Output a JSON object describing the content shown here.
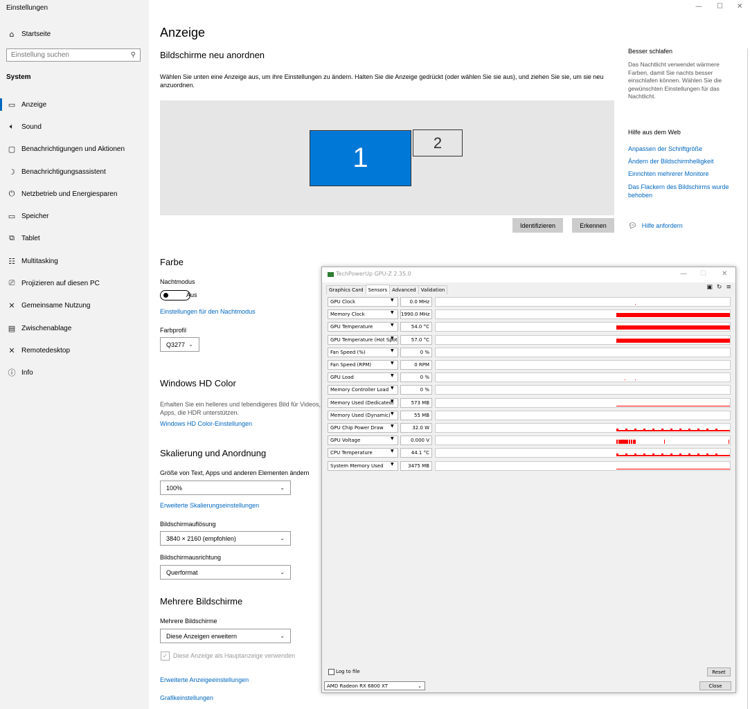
{
  "window": {
    "title": "Einstellungen",
    "min": "—",
    "max": "☐",
    "close": "✕"
  },
  "sidebar": {
    "home": "Startseite",
    "search_placeholder": "Einstellung suchen",
    "section": "System",
    "items": [
      {
        "label": "Anzeige",
        "icon": "monitor-icon"
      },
      {
        "label": "Sound",
        "icon": "speaker-icon"
      },
      {
        "label": "Benachrichtigungen und Aktionen",
        "icon": "notification-icon"
      },
      {
        "label": "Benachrichtigungsassistent",
        "icon": "moon-icon"
      },
      {
        "label": "Netzbetrieb und Energiesparen",
        "icon": "power-icon"
      },
      {
        "label": "Speicher",
        "icon": "storage-icon"
      },
      {
        "label": "Tablet",
        "icon": "tablet-icon"
      },
      {
        "label": "Multitasking",
        "icon": "multitasking-icon"
      },
      {
        "label": "Projizieren auf diesen PC",
        "icon": "project-icon"
      },
      {
        "label": "Gemeinsame Nutzung",
        "icon": "share-icon"
      },
      {
        "label": "Zwischenablage",
        "icon": "clipboard-icon"
      },
      {
        "label": "Remotedesktop",
        "icon": "remote-icon"
      },
      {
        "label": "Info",
        "icon": "info-icon"
      }
    ]
  },
  "main": {
    "title": "Anzeige",
    "arrange_heading": "Bildschirme neu anordnen",
    "arrange_text": "Wählen Sie unten eine Anzeige aus, um ihre Einstellungen zu ändern. Halten Sie die Anzeige gedrückt (oder wählen Sie sie aus), und ziehen Sie sie, um sie neu anzuordnen.",
    "monitor1": "1",
    "monitor2": "2",
    "identify_btn": "Identifizieren",
    "detect_btn": "Erkennen",
    "color_heading": "Farbe",
    "nightmode_label": "Nachtmodus",
    "nightmode_state": "Aus",
    "nightmode_link": "Einstellungen für den Nachtmodus",
    "profile_label": "Farbprofil",
    "profile_value": "Q3277",
    "hdr_heading": "Windows HD Color",
    "hdr_text_1": "Erhalten Sie ein helleres und lebendigeres Bild für Videos,",
    "hdr_text_2": "Apps, die HDR unterstützen.",
    "hdr_link": "Windows HD Color-Einstellungen",
    "scale_heading": "Skalierung und Anordnung",
    "scale_label": "Größe von Text, Apps und anderen Elementen ändern",
    "scale_value": "100%",
    "scale_link": "Erweiterte Skalierungseinstellungen",
    "res_label": "Bildschirmauflösung",
    "res_value": "3840 × 2160 (empfohlen)",
    "orient_label": "Bildschirmausrichtung",
    "orient_value": "Querformat",
    "multi_heading": "Mehrere Bildschirme",
    "multi_label": "Mehrere Bildschirme",
    "multi_value": "Diese Anzeigen erweitern",
    "main_display_label": "Diese Anzeige als Hauptanzeige verwenden",
    "adv_display_link": "Erweiterte Anzeigeeinstellungen",
    "graphics_link": "Grafikeinstellungen"
  },
  "right": {
    "sleep_heading": "Besser schlafen",
    "sleep_text": "Das Nachtlicht verwendet wärmere Farben, damit Sie nachts besser einschlafen können. Wählen Sie die gewünschten Einstellungen für das Nachtlicht.",
    "help_heading": "Hilfe aus dem Web",
    "links": [
      "Anpassen der Schriftgröße",
      "Ändern der Bildschirmhelligkeit",
      "Einrichten mehrerer Monitore",
      "Das Flackern des Bildschirms wurde behoben"
    ],
    "get_help": "Hilfe anfordern"
  },
  "gpuz": {
    "title": "TechPowerUp GPU-Z 2.35.0",
    "tabs": [
      "Graphics Card",
      "Sensors",
      "Advanced",
      "Validation"
    ],
    "active_tab": "Sensors",
    "sensors": [
      {
        "name": "GPU Clock",
        "value": "0.0 MHz"
      },
      {
        "name": "Memory Clock",
        "value": "1990.0 MHz"
      },
      {
        "name": "GPU Temperature",
        "value": "54.0 °C"
      },
      {
        "name": "GPU Temperature (Hot Spot)",
        "value": "57.0 °C"
      },
      {
        "name": "Fan Speed (%)",
        "value": "0 %"
      },
      {
        "name": "Fan Speed (RPM)",
        "value": "0 RPM"
      },
      {
        "name": "GPU Load",
        "value": "0 %"
      },
      {
        "name": "Memory Controller Load",
        "value": "0 %"
      },
      {
        "name": "Memory Used (Dedicated)",
        "value": "573 MB"
      },
      {
        "name": "Memory Used (Dynamic)",
        "value": "55 MB"
      },
      {
        "name": "GPU Chip Power Draw",
        "value": "32.0 W"
      },
      {
        "name": "GPU Voltage",
        "value": "0.000 V"
      },
      {
        "name": "CPU Temperature",
        "value": "44.1 °C"
      },
      {
        "name": "System Memory Used",
        "value": "3475 MB"
      }
    ],
    "log_to_file": "Log to file",
    "reset": "Reset",
    "close": "Close",
    "device": "AMD Radeon RX 6800 XT",
    "graph_color": "#ff0000"
  }
}
